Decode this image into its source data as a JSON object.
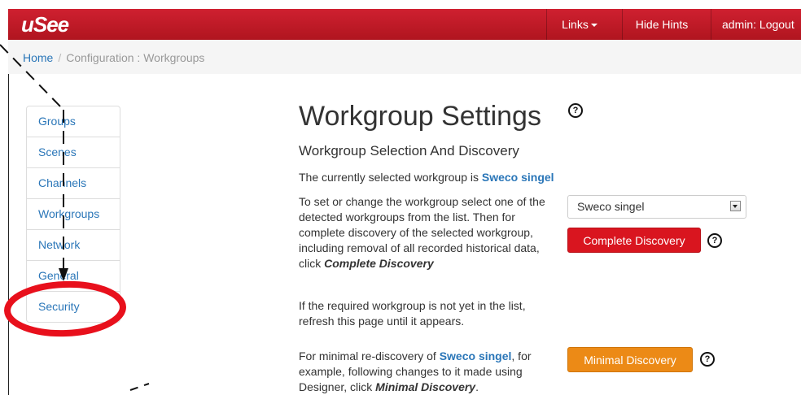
{
  "header": {
    "logo": "uSee",
    "links_label": "Links",
    "hide_hints_label": "Hide Hints",
    "admin_label": "admin: Logout"
  },
  "breadcrumb": {
    "home": "Home",
    "separator": "/",
    "current": "Configuration : Workgroups"
  },
  "sidebar": {
    "items": [
      {
        "label": "Groups"
      },
      {
        "label": "Scenes"
      },
      {
        "label": "Channels"
      },
      {
        "label": "Workgroups"
      },
      {
        "label": "Network"
      },
      {
        "label": "General"
      },
      {
        "label": "Security"
      }
    ]
  },
  "main": {
    "title": "Workgroup Settings",
    "help_glyph": "?",
    "subtitle": "Workgroup Selection And Discovery",
    "selected_prefix": "The currently selected workgroup is ",
    "selected_name": "Sweco singel",
    "desc1_text": "To set or change the workgroup select one of the detected workgroups from the list. Then for complete discovery of the selected workgroup, including removal of all recorded historical data, click ",
    "desc1_action": "Complete Discovery",
    "desc2": "If the required workgroup is not yet in the list, refresh this page until it appears.",
    "desc3_prefix": "For minimal re-discovery of ",
    "desc3_name": "Sweco singel",
    "desc3_middle": ", for example, following changes to it made using Designer, click ",
    "desc3_action": "Minimal Discovery",
    "desc3_end": ".",
    "workgroup_select_value": "Sweco singel",
    "complete_button": "Complete Discovery",
    "minimal_button": "Minimal Discovery"
  },
  "colors": {
    "brand_red": "#c81a28",
    "link_blue": "#2a76b8",
    "complete_red": "#d9151f",
    "minimal_orange": "#ec8a16",
    "annotation_red": "#e8101c"
  },
  "icons": [
    "help-icon",
    "chevron-down-icon",
    "caret-down-icon"
  ]
}
